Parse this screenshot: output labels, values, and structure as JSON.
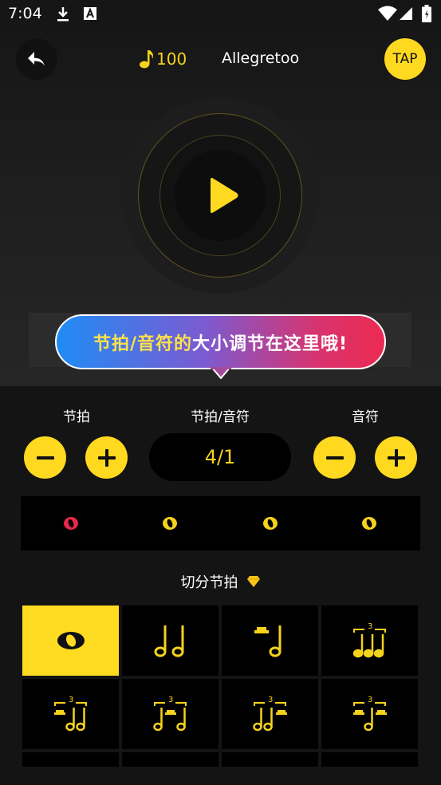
{
  "status_bar": {
    "time": "7:04",
    "icons": [
      "download-icon",
      "text-notification-icon",
      "wifi-icon",
      "signal-icon",
      "battery-icon"
    ]
  },
  "header": {
    "back_icon": "back-arrow-icon",
    "tempo_icon": "music-note-icon",
    "tempo_value": "100",
    "tempo_name": "Allegretoo",
    "tap_label": "TAP"
  },
  "player": {
    "play_icon": "play-icon"
  },
  "tooltip": {
    "text_highlight": "节拍/音符的",
    "text_rest": "大小调节在这里哦!"
  },
  "controls": {
    "beat_label": "节拍",
    "ratio_label": "节拍/音符",
    "note_label": "音符",
    "ratio_value": "4/1"
  },
  "beats": {
    "count": 4,
    "accent_index": 0,
    "accent_color": "#e8274b",
    "normal_color": "#f5d21c"
  },
  "rhythm_section": {
    "title": "切分节拍",
    "badge_icon": "diamond-icon",
    "selected_index": 0,
    "patterns": [
      "whole-note-icon",
      "two-half-notes-icon",
      "rest-half-note-icon",
      "quarter-triplet-icon",
      "rest-triplet-icon",
      "split-triplet-icon",
      "triplet-rest-icon",
      "rest-triplet-rest-icon"
    ]
  },
  "colors": {
    "accent_yellow": "#ffd91f",
    "background": "#141414",
    "accent_red": "#e8274b"
  }
}
